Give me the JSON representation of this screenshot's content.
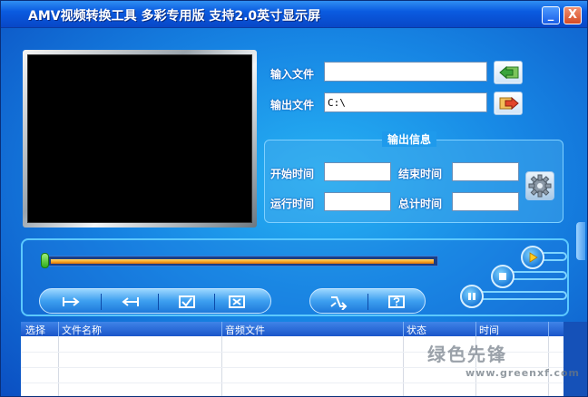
{
  "window": {
    "title": "AMV视频转换工具 多彩专用版 支持2.0英寸显示屏",
    "minimize_label": "_",
    "close_label": "X"
  },
  "files": {
    "input_label": "输入文件",
    "input_value": "",
    "output_label": "输出文件",
    "output_value": "C:\\"
  },
  "output_info": {
    "title": "输出信息",
    "start_time_label": "开始时间",
    "start_time_value": "",
    "end_time_label": "结束时间",
    "end_time_value": "",
    "run_time_label": "运行时间",
    "run_time_value": "",
    "total_time_label": "总计时间",
    "total_time_value": ""
  },
  "progress": {
    "value": 0.0
  },
  "table": {
    "columns": [
      "选择",
      "文件名称",
      "音频文件",
      "状态",
      "时间"
    ]
  },
  "watermark": {
    "text": "绿色先锋",
    "url": "www.greenxf.com"
  },
  "icons": {
    "input": "folder-arrow-in-icon",
    "output": "folder-arrow-out-icon",
    "settings": "gear-icon",
    "mark_start": "set-start-icon",
    "mark_end": "set-end-icon",
    "check": "check-icon",
    "uncheck": "x-box-icon",
    "convert": "convert-icon",
    "help": "help-icon",
    "play": "play-icon",
    "stop": "stop-icon",
    "pause": "pause-icon"
  },
  "colors": {
    "accent": "#1786e4",
    "title_bar": "#0a5be0",
    "progress": "#f6a11e"
  }
}
